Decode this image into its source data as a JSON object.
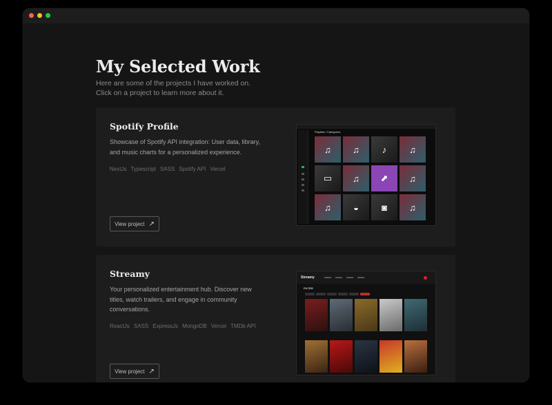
{
  "page": {
    "heading": "My Selected Work",
    "intro_line1": "Here are some of the projects I have worked on.",
    "intro_line2": "Click on a project to learn more about it."
  },
  "projects": [
    {
      "title": "Spotify Profile",
      "description": "Showcase of Spotify API integration: User data, library, and music charts for a personalized experience.",
      "tags": [
        "NextJs",
        "Typescript",
        "SASS",
        "Spotify API",
        "Vercel"
      ],
      "button_label": "View project",
      "button_icon": "arrow-up-right-icon",
      "mockup_label": "Playlists / Categories"
    },
    {
      "title": "Streamy",
      "description": "Your personalized entertainment hub. Discover new titles, watch trailers, and engage in community conversations.",
      "tags": [
        "ReactJs",
        "SASS",
        "ExpressJs",
        "MongoDB",
        "Vercel",
        "TMDb API"
      ],
      "button_label": "View project",
      "button_icon": "arrow-up-right-icon",
      "mockup_logo": "Streamy",
      "mockup_filter": "FILTER"
    }
  ],
  "colors": {
    "window_bg": "#151515",
    "card_bg": "#1d1d1d",
    "spotify_green": "#1db954",
    "streamy_red": "#e02020"
  }
}
